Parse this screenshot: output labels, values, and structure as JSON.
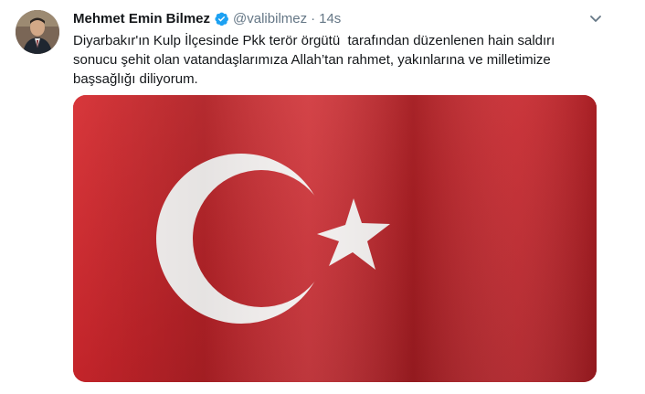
{
  "tweet": {
    "author_name": "Mehmet Emin Bilmez",
    "verified_icon": "verified-badge-icon",
    "handle": "@valibilmez",
    "separator": "·",
    "timestamp": "14s",
    "text": "Diyarbakır'ın Kulp İlçesinde Pkk terör örgütü  tarafından düzenlenen hain saldırı\nsonucu şehit olan vatandaşlarımıza Allah’tan rahmet, yakınlarına ve milletimize\nbaşsağlığı diliyorum.",
    "media_description": "turkish-flag-image",
    "menu_icon": "chevron-down-icon",
    "colors": {
      "flag_red": "#c8262b",
      "verified_blue": "#1da1f2",
      "secondary_text": "#657786"
    }
  }
}
